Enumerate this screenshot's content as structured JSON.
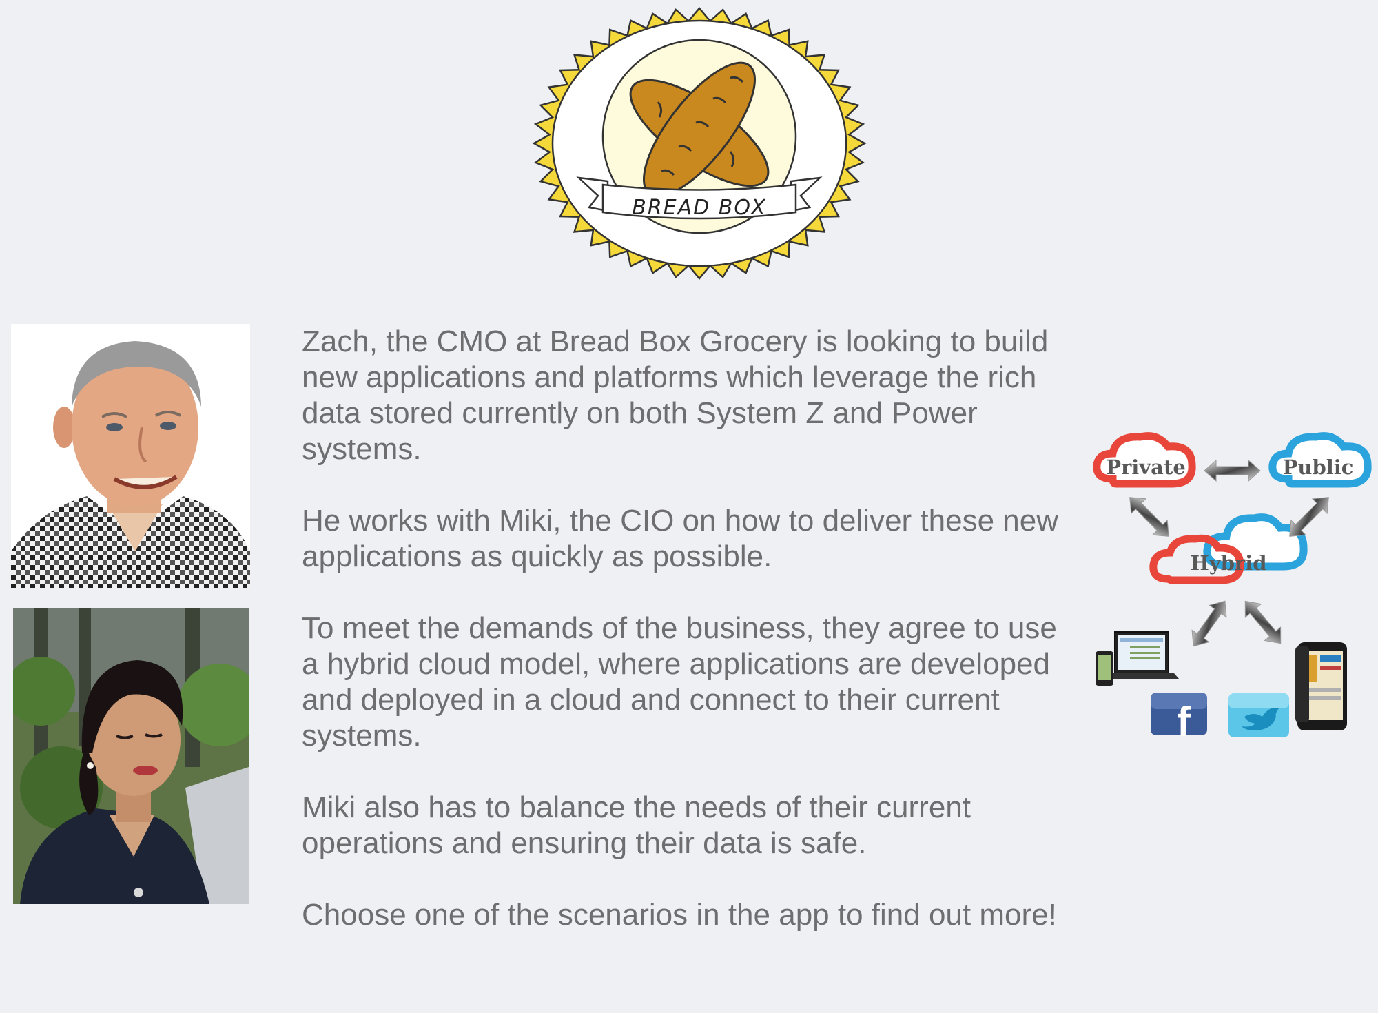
{
  "logo": {
    "text": "BREAD BOX",
    "colors": {
      "burst": "#f5d83a",
      "outline": "#333333",
      "inner": "#fdfbdc",
      "bread": "#c9891f"
    }
  },
  "people": [
    {
      "name": "Zach",
      "role": "CMO"
    },
    {
      "name": "Miki",
      "role": "CIO"
    }
  ],
  "story": {
    "paragraphs": [
      "Zach, the CMO at Bread Box Grocery is looking to build new applications and platforms which leverage the rich data stored currently on both System Z and Power systems.",
      "He works with Miki, the CIO on how to deliver these new applications as quickly as possible.",
      "To meet the demands of the business, they agree to use a hybrid cloud model, where applications are developed and deployed in a cloud and connect to their current systems.",
      "Miki also has to balance the needs of their current operations and ensuring their data is safe.",
      "Choose one of the scenarios in the app to find out more!"
    ],
    "text_color": "#6e6e71"
  },
  "diagram": {
    "clouds": {
      "private": "Private",
      "public": "Public",
      "hybrid": "Hybrid"
    },
    "colors": {
      "private": "#e8463a",
      "public": "#2ba3dc"
    },
    "devices": [
      "laptop-phone-icon",
      "facebook-icon",
      "twitter-icon",
      "smartphone-icon"
    ]
  }
}
